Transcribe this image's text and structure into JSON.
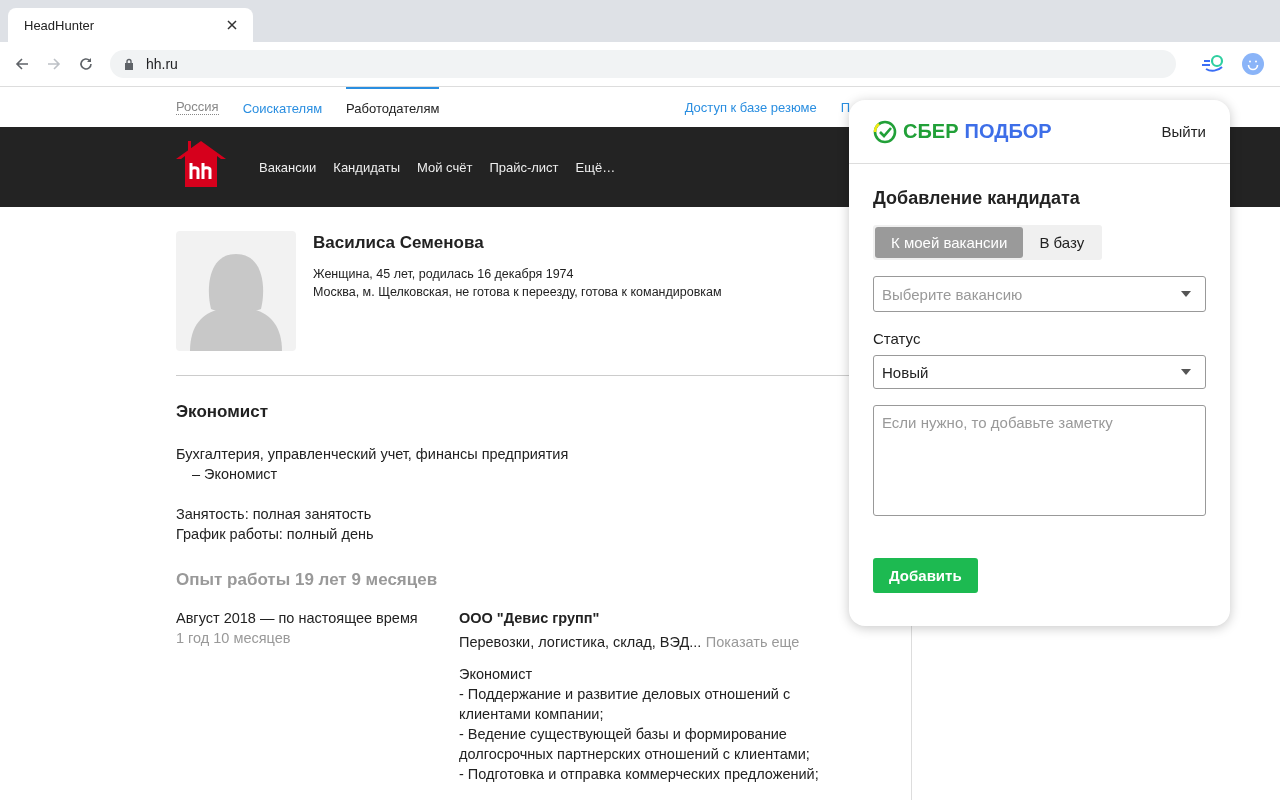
{
  "browser": {
    "tab": {
      "title": "HeadHunter"
    },
    "url": "hh.ru"
  },
  "top_nav": {
    "region": "Россия",
    "links": [
      {
        "label": "Соискателям",
        "selected": false
      },
      {
        "label": "Работодателям",
        "selected": true
      }
    ],
    "right_links": [
      "Доступ к базе резюме",
      "П"
    ]
  },
  "main_nav": [
    "Вакансии",
    "Кандидаты",
    "Мой счёт",
    "Прайс-лист",
    "Ещё…"
  ],
  "resume": {
    "name": "Василиса Семенова",
    "details": [
      "Женщина, 45 лет, родилась 16 декабря 1974",
      "Москва, м. Щелковская, не готова к переезду, готова к командировкам"
    ],
    "position": "Экономист",
    "specialization": "Бухгалтерия, управленческий учет, финансы предприятия",
    "specialization_item": "– Экономист",
    "employment": [
      "Занятость: полная занятость",
      "График работы: полный день"
    ],
    "experience_title": "Опыт работы 19 лет 9 месяцев",
    "jobs": [
      {
        "period": "Август 2018 — по настоящее время",
        "duration": "1 год 10 месяцев",
        "company": "ООО \"Девис групп\"",
        "industry": "Перевозки, логистика, склад, ВЭД...",
        "more": "Показать еще",
        "description": [
          "Экономист",
          "- Поддержание и развитие деловых отношений с клиентами компании;",
          "- Ведение существующей базы и формирование долгосрочных партнерских отношений с клиентами;",
          "- Подготовка и отправка коммерческих предложений;"
        ]
      }
    ]
  },
  "popup": {
    "brand_left": "СБЕР",
    "brand_right": "ПОДБОР",
    "logout": "Выйти",
    "title": "Добавление кандидата",
    "modes": [
      {
        "label": "К моей вакансии",
        "selected": true
      },
      {
        "label": "В базу",
        "selected": false
      }
    ],
    "vacancy": {
      "placeholder": "Выберите вакансию"
    },
    "status_label": "Статус",
    "status": {
      "value": "Новый"
    },
    "note": {
      "placeholder": "Если нужно, то добавьте заметку"
    },
    "submit": "Добавить"
  }
}
